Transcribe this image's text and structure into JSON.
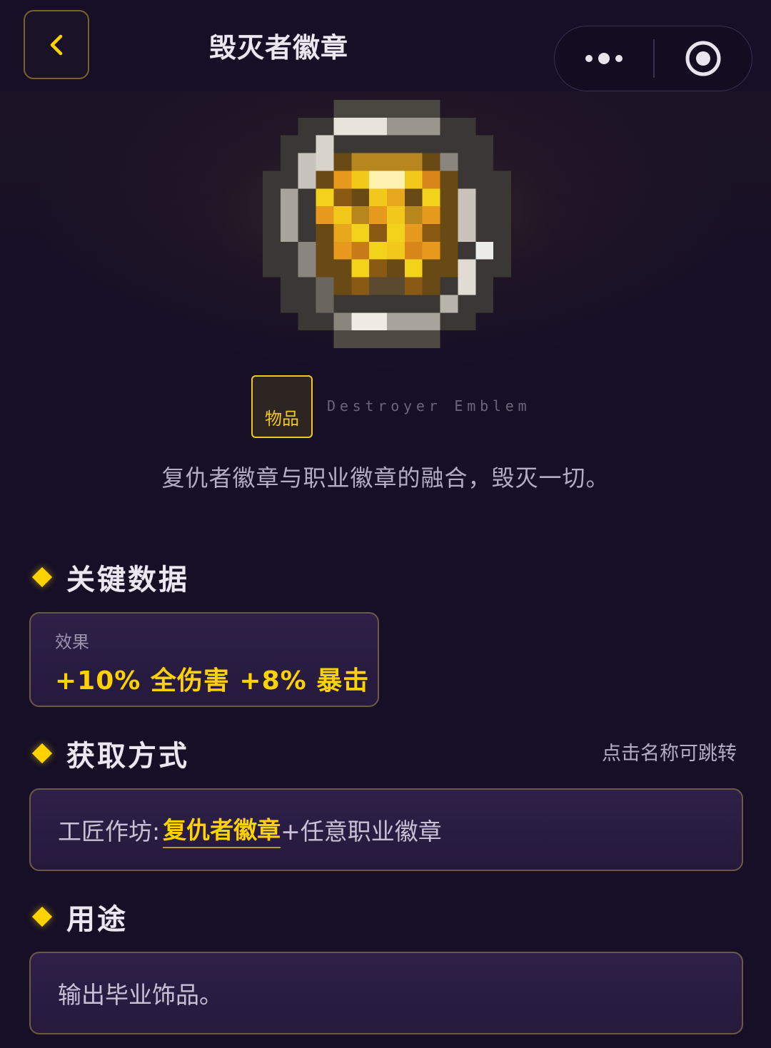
{
  "header": {
    "back_icon": "chevron-left-icon",
    "title": "毁灭者徽章",
    "more_icon": "more-dots-icon",
    "close_icon": "target-circle-icon"
  },
  "item": {
    "image_icon": "emblem-pixel-icon",
    "category_tag": "物品",
    "english_name": "Destroyer Emblem",
    "description": "复仇者徽章与职业徽章的融合，毁灭一切。"
  },
  "sections": {
    "key_data": {
      "title": "关键数据",
      "stat_label": "效果",
      "stat_value": "+10% 全伤害 +8% 暴击"
    },
    "acquisition": {
      "title": "获取方式",
      "hint": "点击名称可跳转",
      "prefix": "工匠作坊:",
      "link": "复仇者徽章",
      "suffix": "+任意职业徽章"
    },
    "usage": {
      "title": "用途",
      "text": "输出毕业饰品。"
    }
  },
  "colors": {
    "background": "#160f26",
    "accent_yellow": "#ffd200",
    "card_border": "#6d5a45",
    "card_bg": "#2a1d42"
  }
}
